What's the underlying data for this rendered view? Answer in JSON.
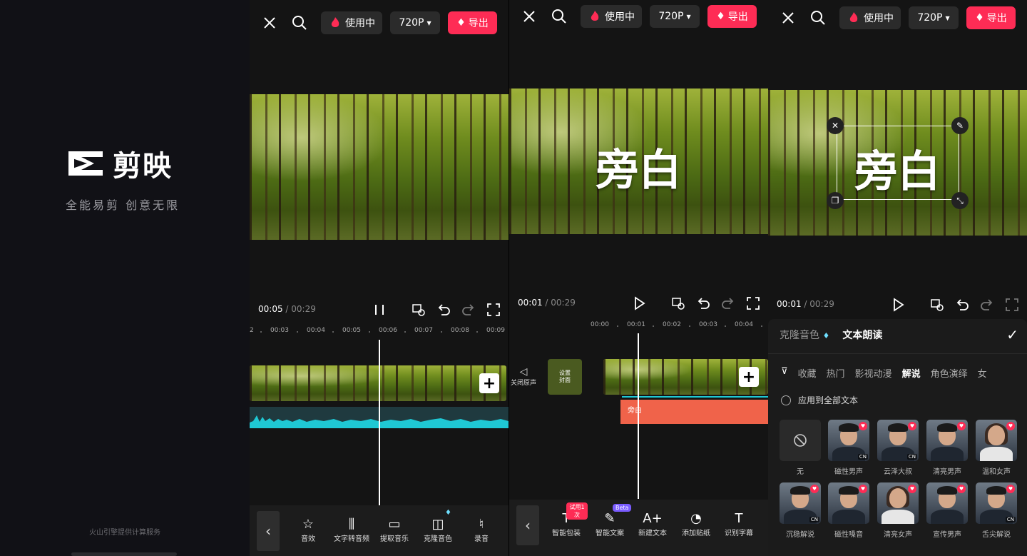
{
  "splash": {
    "logo_text": "剪映",
    "slogan": "全能易剪  创意无限",
    "footer": "火山引擎提供计算服务"
  },
  "topbar": {
    "in_use": "使用中",
    "resolution": "720P",
    "export": "导出"
  },
  "panel2": {
    "time_current": "00:05",
    "time_total": "/ 00:29",
    "ruler": [
      "2",
      "00:03",
      "00:04",
      "00:05",
      "00:06",
      "00:07",
      "00:08",
      "00:09"
    ],
    "tools": [
      {
        "icon": "☆",
        "label": "音效"
      },
      {
        "icon": "⫼",
        "label": "文字转音频"
      },
      {
        "icon": "▭",
        "label": "提取音乐"
      },
      {
        "icon": "◫",
        "label": "克隆音色"
      },
      {
        "icon": "♮",
        "label": "录音"
      }
    ]
  },
  "panel3": {
    "overlay": "旁白",
    "time_current": "00:01",
    "time_total": "/ 00:29",
    "ruler": [
      "00:00",
      "00:01",
      "00:02",
      "00:03",
      "00:04"
    ],
    "mute_label": "关闭原声",
    "cover_label": "设置\n封面",
    "text_clip": "旁白",
    "tools": [
      {
        "icon": "T",
        "label": "智能包装",
        "badge": "试用1次"
      },
      {
        "icon": "✎",
        "label": "智能文案",
        "badge": "Beta"
      },
      {
        "icon": "A+",
        "label": "新建文本"
      },
      {
        "icon": "◔",
        "label": "添加贴纸"
      },
      {
        "icon": "T",
        "label": "识别字幕"
      }
    ]
  },
  "panel4": {
    "overlay": "旁白",
    "time_current": "00:01",
    "time_total": "/ 00:29",
    "tab_clone": "克隆音色",
    "tab_read": "文本朗读",
    "categories": [
      "收藏",
      "热门",
      "影视动漫",
      "解说",
      "角色演绎",
      "女"
    ],
    "active_category": "解说",
    "apply_all": "应用到全部文本",
    "voices": [
      {
        "label": "无",
        "kind": "none"
      },
      {
        "label": "磁性男声",
        "kind": "m",
        "cn": true
      },
      {
        "label": "云泽大叔",
        "kind": "m",
        "cn": true
      },
      {
        "label": "清亮男声",
        "kind": "m"
      },
      {
        "label": "温和女声",
        "kind": "f"
      },
      {
        "label": "沉稳解说",
        "kind": "m",
        "cn": true
      },
      {
        "label": "磁性嗓音",
        "kind": "m"
      },
      {
        "label": "清亮女声",
        "kind": "f"
      },
      {
        "label": "宣传男声",
        "kind": "m"
      },
      {
        "label": "舌尖解说",
        "kind": "m",
        "cn": true
      }
    ]
  },
  "colors": {
    "accent": "#fe2c55",
    "text_clip": "#f0634a",
    "waveform": "#1fc8d4"
  }
}
